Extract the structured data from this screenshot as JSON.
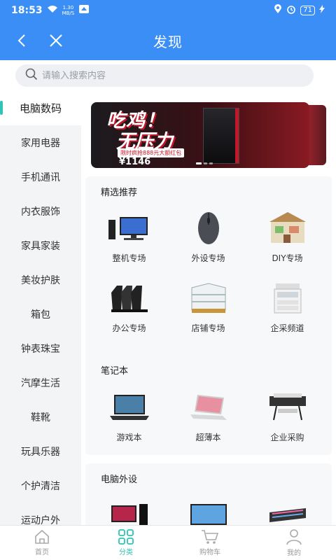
{
  "status": {
    "time": "18:53",
    "net_speed_value": "1.30",
    "net_speed_unit": "MB/S",
    "battery": "71"
  },
  "titlebar": {
    "title": "发现"
  },
  "search": {
    "placeholder": "请输入搜索内容"
  },
  "sidebar": {
    "items": [
      {
        "label": "电脑数码"
      },
      {
        "label": "家用电器"
      },
      {
        "label": "手机通讯"
      },
      {
        "label": "内衣服饰"
      },
      {
        "label": "家具家装"
      },
      {
        "label": "美妆护肤"
      },
      {
        "label": "箱包"
      },
      {
        "label": "钟表珠宝"
      },
      {
        "label": "汽摩生活"
      },
      {
        "label": "鞋靴"
      },
      {
        "label": "玩具乐器"
      },
      {
        "label": "个护清洁"
      },
      {
        "label": "运动户外"
      }
    ]
  },
  "banner": {
    "line1": "吃鸡！",
    "line2": "无压力",
    "promo": "限时疯抢888元大额红包",
    "price": "¥1146"
  },
  "sections": [
    {
      "title": "精选推荐",
      "items": [
        {
          "label": "整机专场"
        },
        {
          "label": "外设专场"
        },
        {
          "label": "DIY专场"
        },
        {
          "label": "办公专场"
        },
        {
          "label": "店铺专场"
        },
        {
          "label": "企采频道"
        }
      ]
    },
    {
      "title": "笔记本",
      "items": [
        {
          "label": "游戏本"
        },
        {
          "label": "超薄本"
        },
        {
          "label": "企业采购"
        }
      ]
    },
    {
      "title": "电脑外设",
      "items": []
    }
  ],
  "tabbar": {
    "items": [
      {
        "label": "首页"
      },
      {
        "label": "分类"
      },
      {
        "label": "购物车"
      },
      {
        "label": "我的"
      }
    ]
  },
  "colors": {
    "header": "#3a8ef5",
    "accent": "#2ec4b6"
  }
}
